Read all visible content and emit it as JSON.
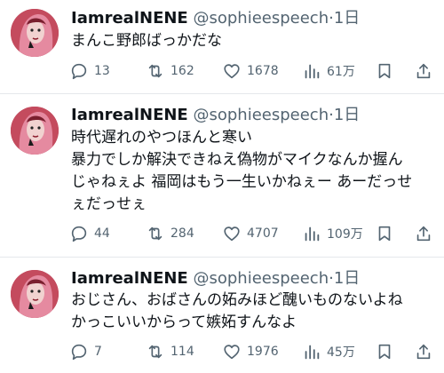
{
  "tweets": [
    {
      "name": "IamrealNENE",
      "handle": "@sophieespeech",
      "time": "1日",
      "lines": [
        "まんこ野郎ばっかだな"
      ],
      "replies": "13",
      "retweets": "162",
      "likes": "1678",
      "views": "61万"
    },
    {
      "name": "IamrealNENE",
      "handle": "@sophieespeech",
      "time": "1日",
      "lines": [
        "時代遅れのやつほんと寒い",
        "暴力でしか解決できねえ偽物がマイクなんか握ん",
        "じゃねぇよ 福岡はもう一生いかねぇー あーだっせ",
        "ぇだっせぇ"
      ],
      "replies": "44",
      "retweets": "284",
      "likes": "4707",
      "views": "109万"
    },
    {
      "name": "IamrealNENE",
      "handle": "@sophieespeech",
      "time": "1日",
      "lines": [
        "おじさん、おばさんの妬みほど醜いものないよね",
        "かっこいいからって嫉妬すんなよ"
      ],
      "replies": "7",
      "retweets": "114",
      "likes": "1976",
      "views": "45万"
    }
  ],
  "separator": "·",
  "icons": {
    "reply": "reply-icon",
    "retweet": "retweet-icon",
    "like": "heart-icon",
    "views": "views-chart-icon",
    "bookmark": "bookmark-icon",
    "share": "share-icon"
  },
  "colors": {
    "text": "#0f1419",
    "secondary": "#536471",
    "divider": "#e5e8eb",
    "avatar": "#b9475a"
  }
}
